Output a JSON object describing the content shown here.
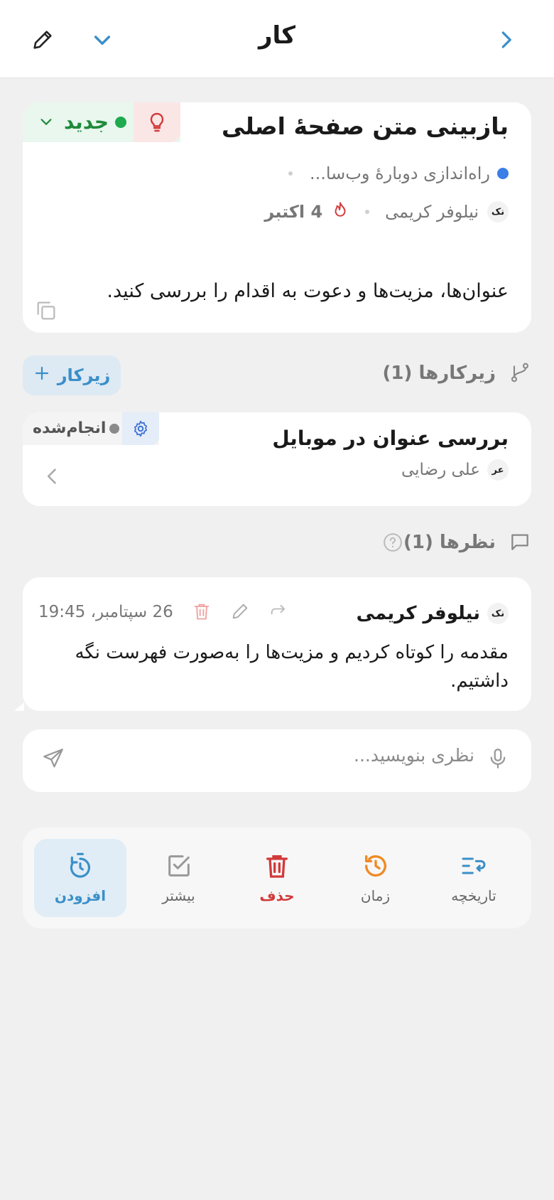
{
  "header": {
    "title": "کار"
  },
  "task": {
    "title": "بازبینی متن صفحهٔ اصلی",
    "status": "جدید",
    "project": "راه‌اندازی دوبارهٔ وب‌سا...",
    "assignee_initials": "نک",
    "assignee": "نیلوفر کریمی",
    "due": "4 اکتبر",
    "description": "عنوان‌ها، مزیت‌ها و دعوت به اقدام را بررسی کنید."
  },
  "subtasks": {
    "label": "زیرکارها (1)",
    "add_label": "زیرکار",
    "items": [
      {
        "title": "بررسی عنوان در موبایل",
        "status": "انجام‌شده",
        "assignee_initials": "عر",
        "assignee": "علی رضایی"
      }
    ]
  },
  "comments": {
    "label": "نظرها (1)",
    "items": [
      {
        "author_initials": "نک",
        "author": "نیلوفر کریمی",
        "time": "26 سپتامبر، 19:45",
        "text": "مقدمه را کوتاه کردیم و مزیت‌ها را به‌صورت فهرست نگه داشتیم."
      }
    ],
    "input_placeholder": "نظری بنویسید..."
  },
  "actions": [
    {
      "label": "تاریخچه",
      "icon": "history-list-icon"
    },
    {
      "label": "زمان",
      "icon": "clock-rewind-icon"
    },
    {
      "label": "حذف",
      "icon": "trash-icon"
    },
    {
      "label": "بیشتر",
      "icon": "checkbox-icon"
    },
    {
      "label": "افزودن",
      "icon": "timer-add-icon"
    }
  ],
  "colors": {
    "accent": "#3a8fc9",
    "status_new": "#1f8a3b",
    "danger": "#d23a3a",
    "clock": "#f08a24"
  }
}
